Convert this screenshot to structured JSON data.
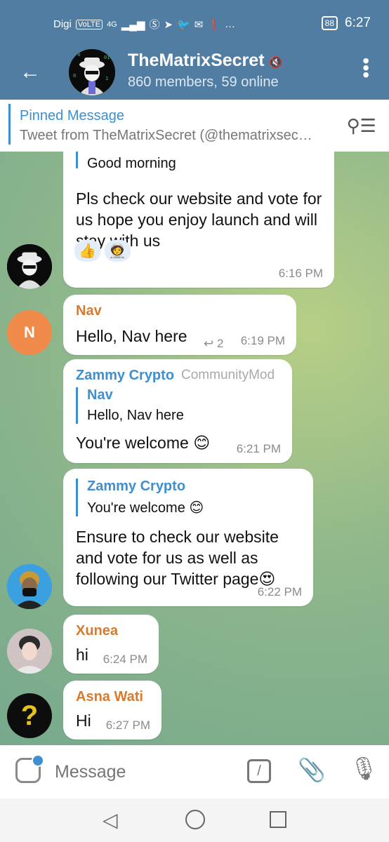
{
  "status": {
    "carrier": "Digi",
    "volte": "VoLTE",
    "net": "4G",
    "battery": "88",
    "time": "6:27"
  },
  "header": {
    "title": "TheMatrixSecret",
    "subtitle": "860 members, 59 online"
  },
  "pinned": {
    "title": "Pinned Message",
    "text": "Tweet from TheMatrixSecret (@thematrixsec…"
  },
  "messages": [
    {
      "quote_text": "Good morning",
      "text": "Pls check our website and vote for us hope you enjoy launch and will stay with us",
      "reactions": [
        "👍",
        "🧑‍🚀"
      ],
      "time": "6:16 PM"
    },
    {
      "sender": "Nav",
      "sender_color": "#d97a2b",
      "avatar_letter": "N",
      "avatar_color": "#f08a4b",
      "text": "Hello, Nav here",
      "reply_count": "2",
      "time": "6:19 PM"
    },
    {
      "sender": "Zammy Crypto",
      "sender_color": "#3d8fd0",
      "role": "CommunityMod",
      "quote_name": "Nav",
      "quote_text": "Hello, Nav here",
      "text": "You're welcome 😊",
      "time": "6:21 PM"
    },
    {
      "quote_name": "Zammy Crypto",
      "quote_text": "You're welcome 😊",
      "text": "Ensure to check our website and vote for us as well as following our Twitter page😍",
      "time": "6:22 PM"
    },
    {
      "sender": "Xunea",
      "sender_color": "#d97a2b",
      "text": "hi",
      "time": "6:24 PM"
    },
    {
      "sender": "Asna Wati",
      "sender_color": "#d97a2b",
      "text": "Hi",
      "time": "6:27 PM"
    }
  ],
  "input": {
    "placeholder": "Message"
  }
}
